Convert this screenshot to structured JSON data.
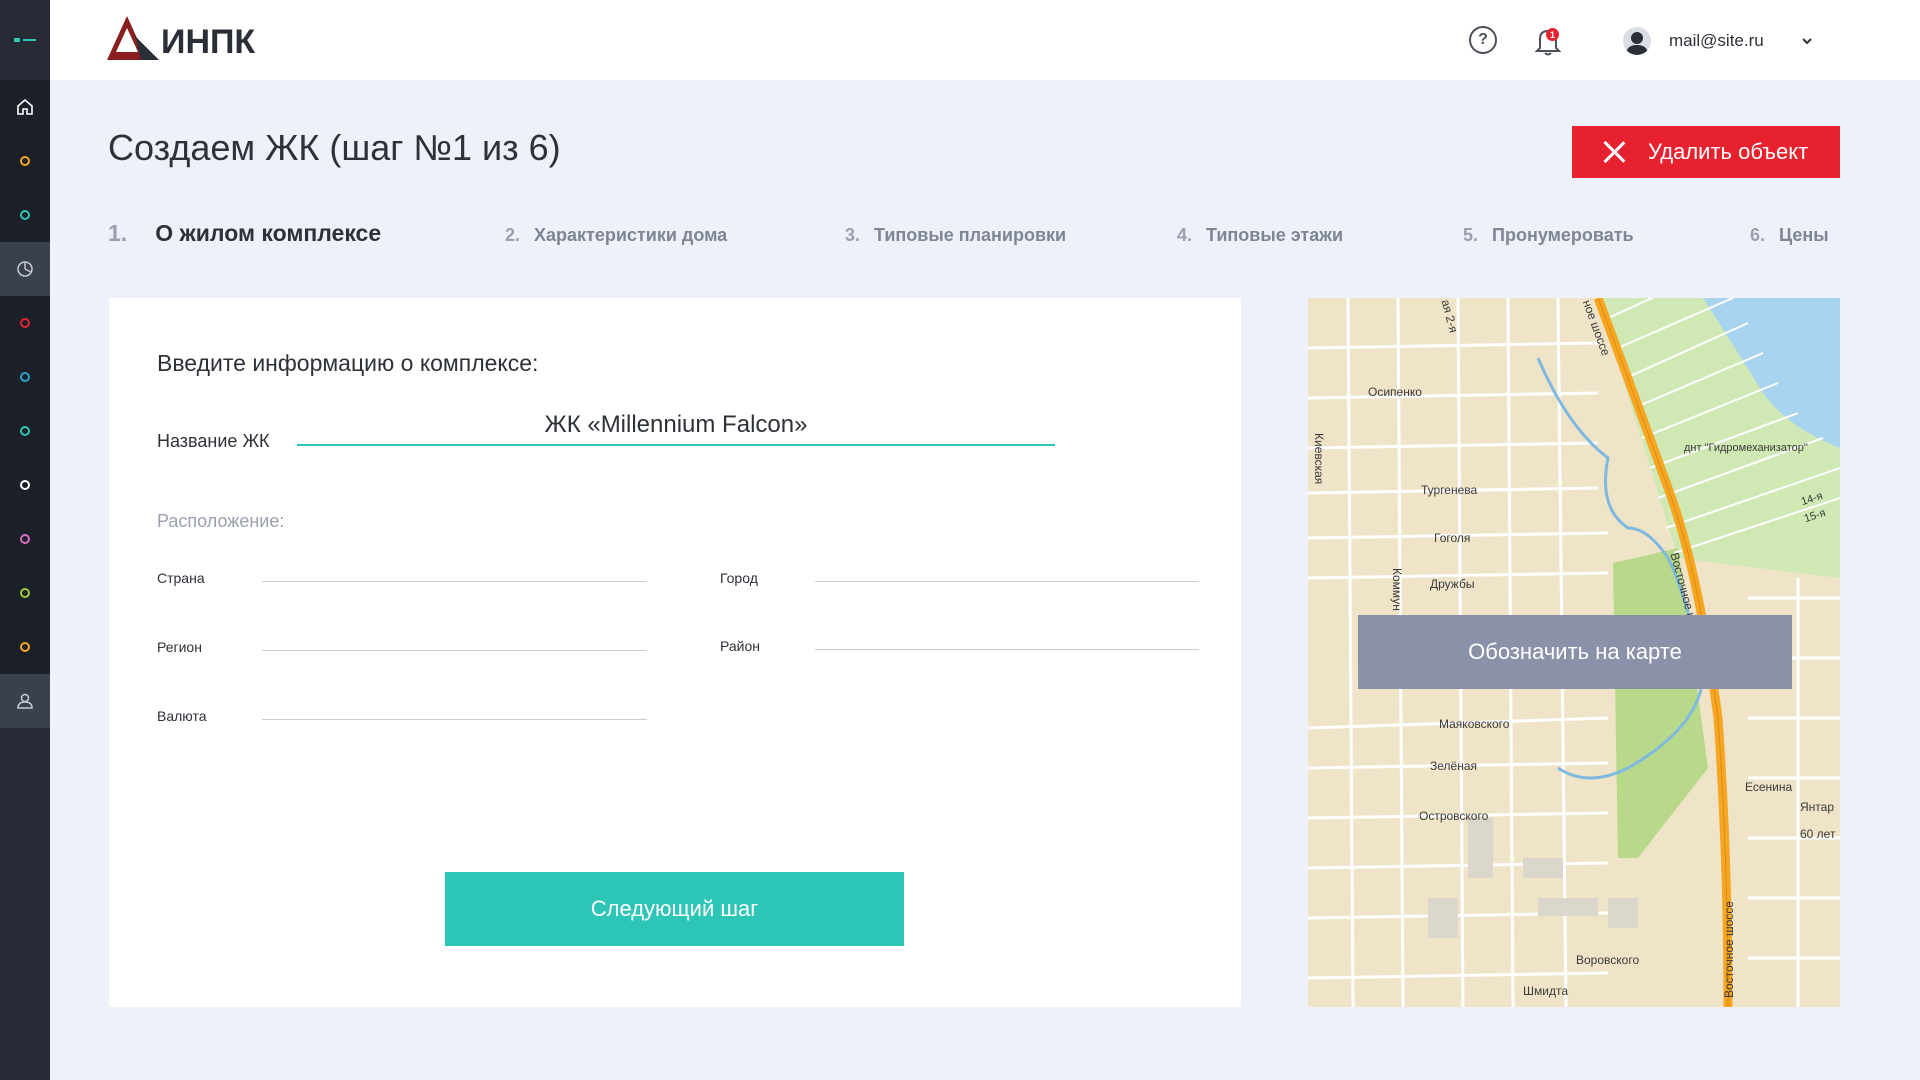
{
  "app": {
    "logo_text": "ИНПК"
  },
  "header": {
    "user_email": "mail@site.ru",
    "notification_count": "1"
  },
  "page": {
    "title": "Создаем ЖК (шаг №1 из 6)",
    "delete_label": "Удалить объект"
  },
  "steps": [
    {
      "num": "1.",
      "label": "О жилом комплексе",
      "active": true
    },
    {
      "num": "2.",
      "label": "Характеристики дома"
    },
    {
      "num": "3.",
      "label": "Типовые планировки"
    },
    {
      "num": "4.",
      "label": "Типовые этажи"
    },
    {
      "num": "5.",
      "label": "Пронумеровать"
    },
    {
      "num": "6.",
      "label": "Цены"
    }
  ],
  "form": {
    "title": "Введите информацию о комплексе:",
    "name_label": "Название ЖК",
    "name_value": "ЖК «Millennium Falcon»",
    "location_label": "Расположение:",
    "country_label": "Страна",
    "city_label": "Город",
    "region_label": "Регион",
    "district_label": "Район",
    "currency_label": "Валюта",
    "next_label": "Следующий шаг"
  },
  "map": {
    "button_label": "Обозначить на карте",
    "streets": [
      "Осипенко",
      "Тургенева",
      "Гоголя",
      "Дружбы",
      "Маяковского",
      "Зелёная",
      "Островского",
      "Воровского",
      "Шмидта",
      "Есенина",
      "Янтар",
      "60 лет",
      "днт \"Гидромеханизатор\"",
      "14-я",
      "15-я",
      "Киевская",
      "Коммун",
      "ая 2-я",
      "Восточное шоссе",
      "Восточное шоссе",
      "ное шоссе"
    ]
  },
  "sidebar": {
    "icons": [
      "menu-icon",
      "home-icon",
      "chart-icon",
      "user-icon"
    ],
    "dot_colors": [
      "#f5a623",
      "#2dc5b5",
      "#e3232f",
      "#2da0c5",
      "#2dc5b5",
      "#ffffff",
      "#d86fc0",
      "#a2c93a",
      "#f5a623"
    ]
  }
}
